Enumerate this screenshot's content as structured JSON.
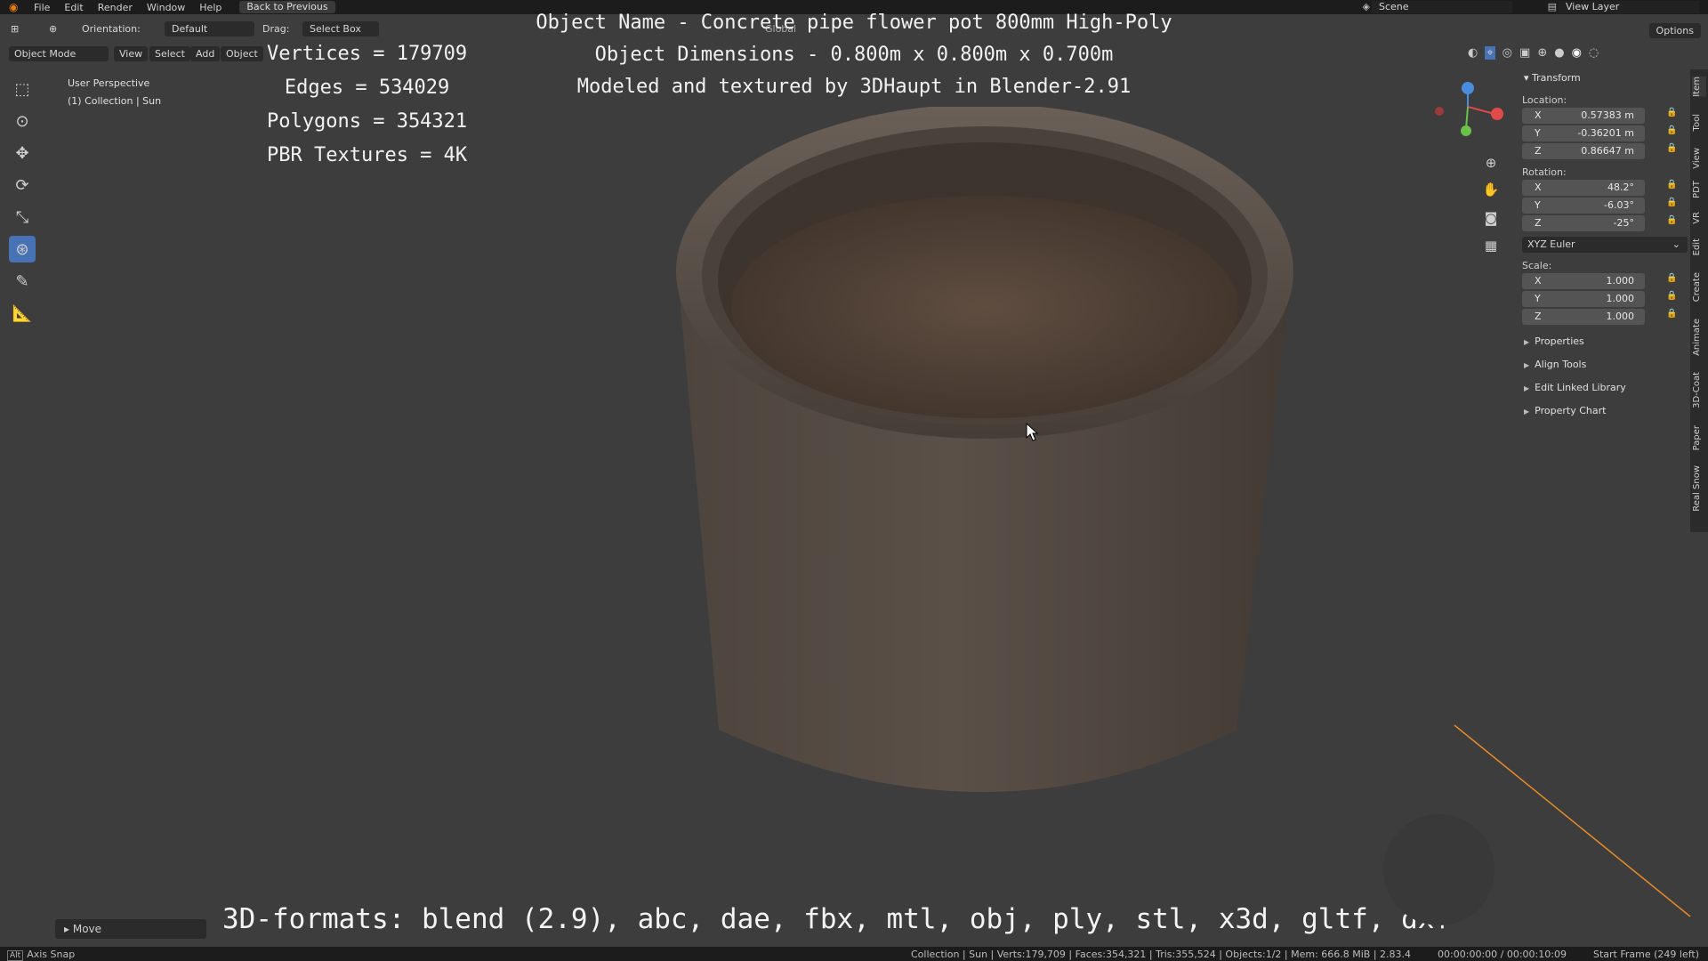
{
  "top_menu": {
    "items": [
      "File",
      "Edit",
      "Render",
      "Window",
      "Help"
    ],
    "back_label": "Back to Previous",
    "scene_label": "Scene",
    "view_layer_label": "View Layer"
  },
  "header": {
    "orientation_label": "Orientation:",
    "orientation_value": "Default",
    "drag_label": "Drag:",
    "drag_value": "Select Box",
    "transform_space": "Global",
    "options_label": "Options"
  },
  "subheader": {
    "mode": "Object Mode",
    "view": "View",
    "select": "Select",
    "add": "Add",
    "object": "Object"
  },
  "viewport": {
    "perspective": "User Perspective",
    "collection": "(1) Collection | Sun"
  },
  "overlay": {
    "vertices": "Vertices = 179709",
    "edges": "Edges = 534029",
    "polygons": "Polygons = 354321",
    "textures": "PBR Textures = 4K",
    "name": "Object Name - Concrete pipe flower pot 800mm High-Poly",
    "dimensions": "Object Dimensions -  0.800m x 0.800m x 0.700m",
    "credit": "Modeled and textured by 3DHaupt in Blender-2.91",
    "formats": "3D-formats: blend (2.9), abc, dae, fbx, mtl, obj, ply, stl, x3d, gltf, dxf"
  },
  "npanel": {
    "transform": "Transform",
    "location_label": "Location:",
    "location": [
      {
        "axis": "X",
        "value": "0.57383 m"
      },
      {
        "axis": "Y",
        "value": "-0.36201 m"
      },
      {
        "axis": "Z",
        "value": "0.86647 m"
      }
    ],
    "rotation_label": "Rotation:",
    "rotation": [
      {
        "axis": "X",
        "value": "48.2°"
      },
      {
        "axis": "Y",
        "value": "-6.03°"
      },
      {
        "axis": "Z",
        "value": "-25°"
      }
    ],
    "rotation_mode": "XYZ Euler",
    "scale_label": "Scale:",
    "scale": [
      {
        "axis": "X",
        "value": "1.000"
      },
      {
        "axis": "Y",
        "value": "1.000"
      },
      {
        "axis": "Z",
        "value": "1.000"
      }
    ],
    "sections": [
      "Properties",
      "Align Tools",
      "Edit Linked Library",
      "Property Chart"
    ]
  },
  "side_tabs": [
    "Item",
    "Tool",
    "View",
    "PDT",
    "VR",
    "Edit",
    "Create",
    "Animate",
    "3D-Coat",
    "Paper",
    "Real Snow"
  ],
  "last_operator": "Move",
  "status": {
    "left": "Axis Snap",
    "stats": "Collection | Sun | Verts:179,709 | Faces:354,321 | Tris:355,524 | Objects:1/2 | Mem: 666.8 MiB | 2.83.4",
    "time": "00:00:00:00 / 00:00:10:09",
    "frame": "Start Frame (249 left)"
  }
}
